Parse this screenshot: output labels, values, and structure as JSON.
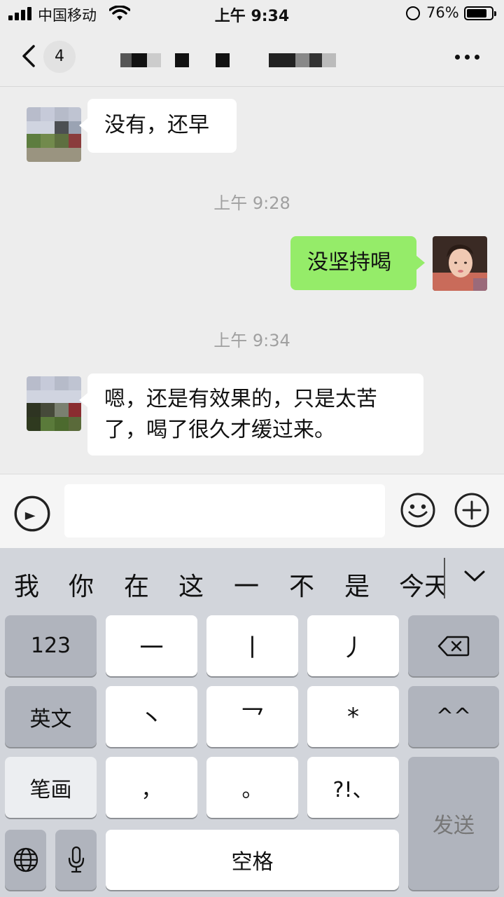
{
  "status_bar": {
    "carrier": "中国移动",
    "time": "上午 9:34",
    "battery_percent": "76%",
    "battery_level": 0.76
  },
  "nav": {
    "unread_count": "4",
    "more_icon": "ellipsis-icon",
    "back_icon": "chevron-left-icon"
  },
  "messages": [
    {
      "side": "left",
      "text": "没有，还早"
    },
    {
      "side": "right",
      "text": "没坚持喝"
    },
    {
      "side": "left",
      "text": "嗯，还是有效果的，只是太苦了，喝了很久才缓过来。"
    }
  ],
  "timestamps": [
    "上午 9:28",
    "上午 9:34"
  ],
  "input": {
    "placeholder": ""
  },
  "keyboard": {
    "candidates": [
      "我",
      "你",
      "在",
      "这",
      "一",
      "不",
      "是",
      "今天"
    ],
    "keys": {
      "num": "123",
      "en": "英文",
      "bihua": "笔画",
      "heng": "一",
      "shu": "丨",
      "pie": "丿",
      "dian": "丶",
      "zhe": "乛",
      "wild": "*",
      "comma": "，",
      "period": "。",
      "punct": "?!、",
      "smile": "^^",
      "space": "空格",
      "send": "发送"
    }
  },
  "colors": {
    "chat_background": "#ededed",
    "sent_bubble": "#95ec69",
    "received_bubble": "#ffffff",
    "keyboard_background": "#d2d5db"
  }
}
